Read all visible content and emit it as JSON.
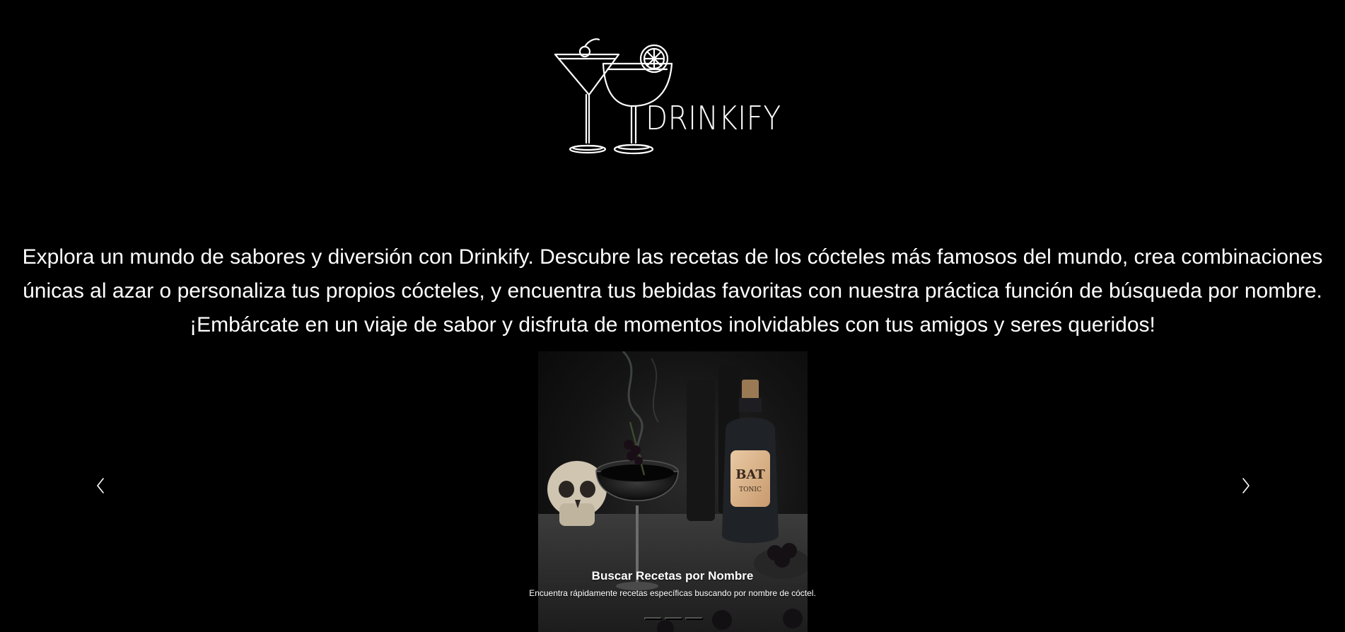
{
  "header": {
    "brand": "DRINKIFY",
    "logo_icon": "cocktail-glasses-icon"
  },
  "intro": {
    "text": "Explora un mundo de sabores y diversión con Drinkify. Descubre las recetas de los cócteles más famosos del mundo, crea combinaciones únicas al azar o personaliza tus propios cócteles, y encuentra tus bebidas favoritas con nuestra práctica función de búsqueda por nombre. ¡Embárcate en un viaje de sabor y disfruta de momentos inolvidables con tus amigos y seres queridos!"
  },
  "carousel": {
    "active_index": 0,
    "slide_count": 3,
    "caption_title": "Buscar Recetas por Nombre",
    "caption_text": "Encuentra rápidamente recetas específicas buscando por nombre de cóctel.",
    "slide_image": "dark-cocktail-with-skull-photo",
    "bottle_label": "BAT",
    "bottle_sublabel": "TONIC",
    "prev_icon": "chevron-left-icon",
    "next_icon": "chevron-right-icon"
  },
  "colors": {
    "background": "#000000",
    "text": "#ffffff"
  }
}
